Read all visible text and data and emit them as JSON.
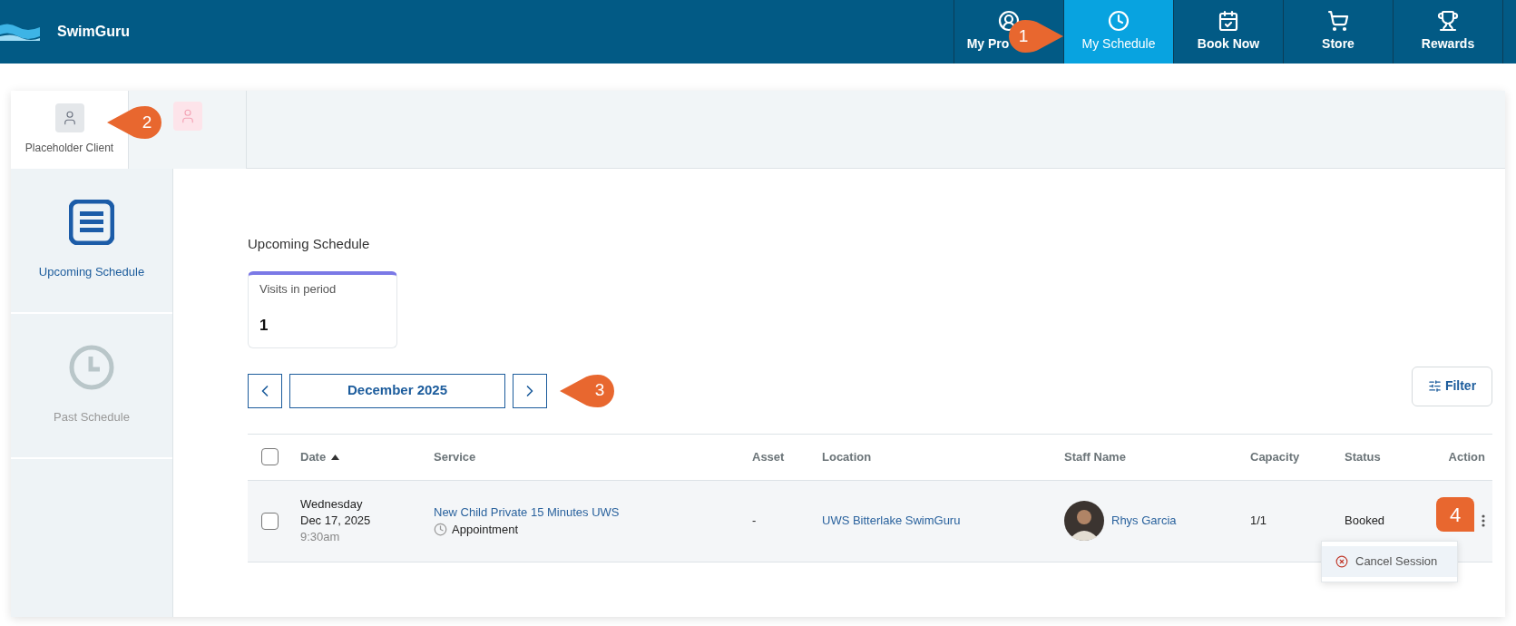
{
  "header": {
    "brand": "SwimGuru",
    "nav": [
      {
        "label": "My Pro",
        "selected": false
      },
      {
        "label": "My Schedule",
        "selected": true
      },
      {
        "label": "Book Now",
        "selected": false
      },
      {
        "label": "Store",
        "selected": false
      },
      {
        "label": "Rewards",
        "selected": false
      }
    ]
  },
  "client_tabs": [
    {
      "label": "Placeholder Client",
      "selected": true
    },
    {
      "selected": false
    }
  ],
  "sidebar": {
    "items": [
      {
        "label": "Upcoming Schedule",
        "selected": true
      },
      {
        "label": "Past Schedule",
        "selected": false
      }
    ]
  },
  "main": {
    "title": "Upcoming Schedule",
    "stat": {
      "label": "Visits in period",
      "value": "1"
    },
    "period": "December 2025",
    "filter": "Filter"
  },
  "table": {
    "columns": [
      "Date",
      "Service",
      "Asset",
      "Location",
      "Staff Name",
      "Capacity",
      "Status",
      "Action"
    ],
    "select_all_checked": false,
    "rows": [
      {
        "checked": false,
        "weekday": "Wednesday",
        "date": "Dec 17, 2025",
        "time": "9:30am",
        "service": "New Child Private 15 Minutes UWS",
        "type": "Appointment",
        "asset": "-",
        "location": "UWS Bitterlake SwimGuru",
        "staff": "Rhys Garcia",
        "capacity": "1/1",
        "status": "Booked"
      }
    ]
  },
  "menu": {
    "items": [
      "Cancel Session"
    ]
  },
  "callouts": [
    {
      "kind": "pointer-right",
      "label": "1"
    },
    {
      "kind": "pointer-left",
      "label": "2"
    },
    {
      "kind": "pointer-left",
      "label": "3"
    },
    {
      "kind": "square",
      "label": "4"
    }
  ]
}
